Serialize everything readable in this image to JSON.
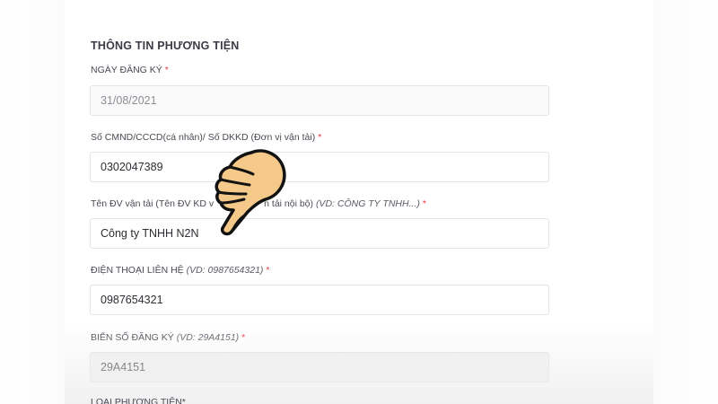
{
  "section": {
    "title": "THÔNG TIN PHƯƠNG TIỆN"
  },
  "fields": {
    "registration_date": {
      "label": "NGÀY ĐĂNG KÝ",
      "required": "*",
      "value": "31/08/2021"
    },
    "id_number": {
      "label": "Số CMND/CCCD(cá nhân)/ Số DKKD (Đơn vị vận tải)",
      "required": "*",
      "value": "0302047389"
    },
    "transport_unit_name": {
      "label_prefix": "Tên ĐV vận tải (Tên ĐV KD v",
      "label_suffix": "n tải nội bộ) ",
      "hint": "(VD: CÔNG TY TNHH...)",
      "required": "*",
      "value": "Công ty TNHH N2N"
    },
    "contact_phone": {
      "label": "ĐIỆN THOẠI LIÊN HỆ ",
      "hint": "(VD: 0987654321)",
      "required": "*",
      "value": "0987654321"
    },
    "license_plate": {
      "label": "BIỂN SỐ ĐĂNG KÝ ",
      "hint": "(VD: 29A4151)",
      "required": "*",
      "value": "29A4151"
    },
    "vehicle_type": {
      "label": "LOẠI PHƯƠNG TIỆN",
      "required": "*"
    }
  },
  "overlay": {
    "icon": "pointing-hand-icon",
    "color": "#f5c98a"
  }
}
